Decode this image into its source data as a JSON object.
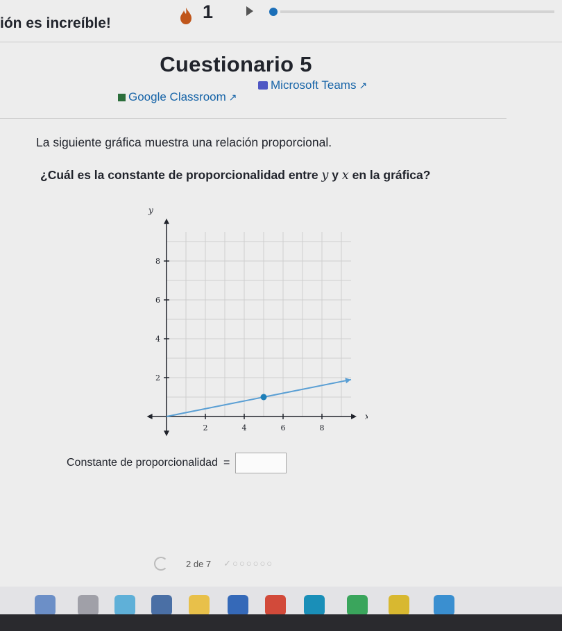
{
  "header": {
    "message": "ión es increíble!",
    "streak_count": "1",
    "colors": {
      "flame": "#c0561b",
      "progress": "#1b6fb8"
    }
  },
  "quiz": {
    "title": "Cuestionario 5",
    "share": {
      "google_classroom": "Google Classroom",
      "microsoft_teams": "Microsoft Teams"
    }
  },
  "problem": {
    "prompt": "La siguiente gráfica muestra una relación proporcional.",
    "question_start": "¿Cuál es la constante de proporcionalidad entre",
    "var_y": "y",
    "conj": "y",
    "var_x": "x",
    "question_end": "en la gráfica?"
  },
  "chart_data": {
    "type": "line",
    "xlabel": "x",
    "ylabel": "y",
    "x_ticks": [
      "2",
      "4",
      "6",
      "8"
    ],
    "y_ticks": [
      "2",
      "4",
      "6",
      "8"
    ],
    "xlim": [
      0,
      9.5
    ],
    "ylim": [
      0,
      9.5
    ],
    "grid": true,
    "series": [
      {
        "x": [
          0,
          9.5
        ],
        "y": [
          0,
          1.9
        ],
        "color": "#5a9fd4"
      }
    ],
    "highlight_point": {
      "x": 5,
      "y": 1
    }
  },
  "answer": {
    "label": "Constante de proporcionalidad",
    "equals": "=",
    "value": ""
  },
  "pager": {
    "text": "2 de 7"
  }
}
